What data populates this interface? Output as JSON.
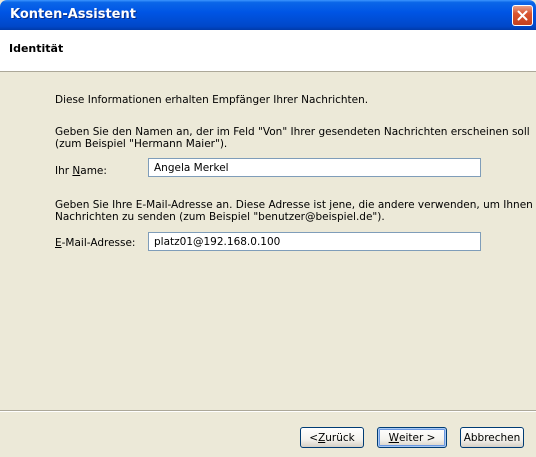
{
  "window": {
    "title": "Konten-Assistent"
  },
  "header": {
    "title": "Identität"
  },
  "content": {
    "intro": "Diese Informationen erhalten Empfänger Ihrer Nachrichten.",
    "name_instruction_line1": "Geben Sie den Namen an, der im Feld \"Von\" Ihrer gesendeten Nachrichten erscheinen soll",
    "name_instruction_line2": "(zum Beispiel \"Hermann Maier\").",
    "name_label_pre": "Ihr ",
    "name_label_accel": "N",
    "name_label_post": "ame:",
    "name_value": "Angela Merkel",
    "email_instruction_line1": "Geben Sie Ihre E-Mail-Adresse an. Diese Adresse ist jene, die andere verwenden, um Ihnen",
    "email_instruction_line2": "Nachrichten zu senden (zum Beispiel \"benutzer@beispiel.de\").",
    "email_label_accel": "E",
    "email_label_post": "-Mail-Adresse:",
    "email_value": "platz01@192.168.0.100"
  },
  "buttons": {
    "back_pre": "< ",
    "back_accel": "Z",
    "back_post": "urück",
    "next_accel": "W",
    "next_post": "eiter >",
    "cancel": "Abbrechen"
  },
  "colors": {
    "titlebar": "#0055E5",
    "dialog_bg": "#ECE9D8",
    "close_button": "#D9542F"
  },
  "icons": {
    "close": "close-icon"
  }
}
